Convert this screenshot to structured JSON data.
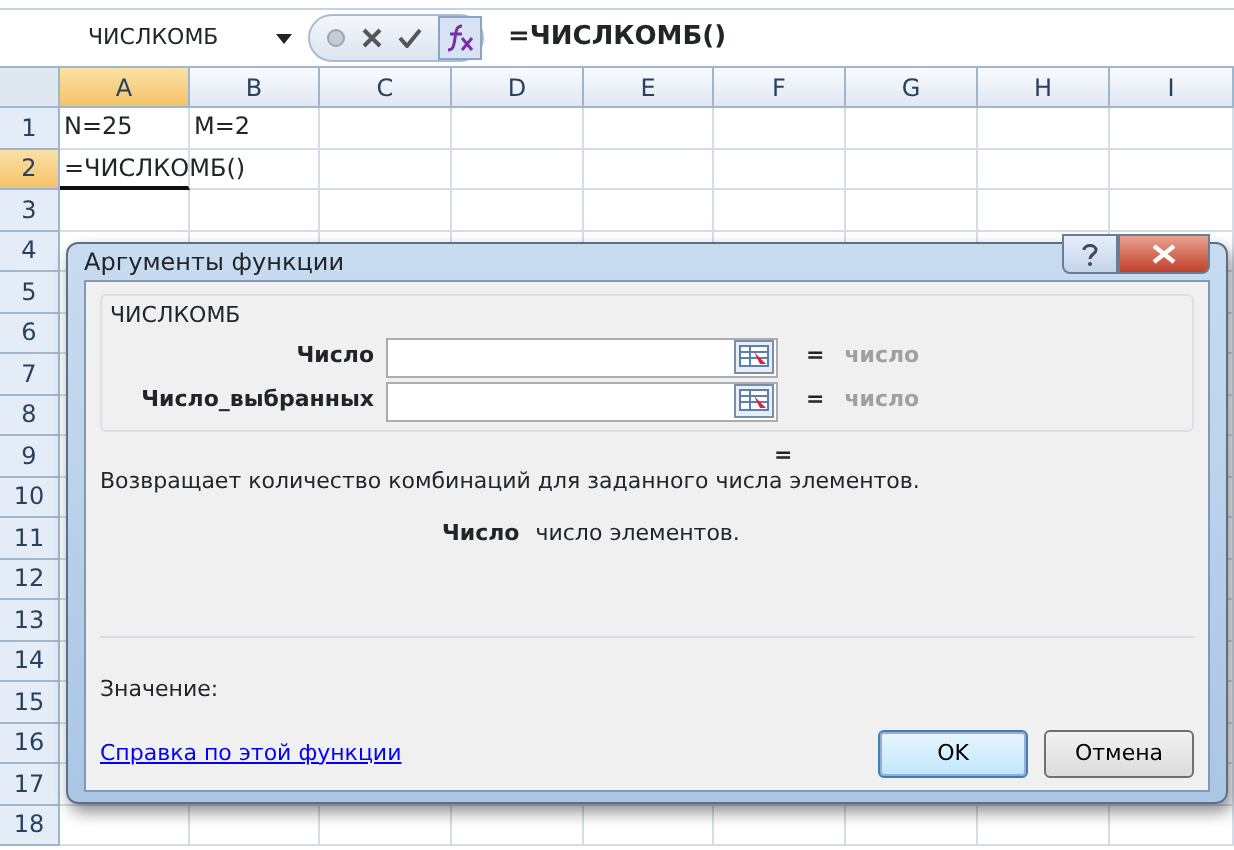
{
  "name_box": {
    "value": "ЧИСЛКОМБ"
  },
  "formula_bar": {
    "value": "=ЧИСЛКОМБ()"
  },
  "columns": [
    {
      "label": "A",
      "selected": true
    },
    {
      "label": "B",
      "selected": false
    },
    {
      "label": "C",
      "selected": false
    },
    {
      "label": "D",
      "selected": false
    },
    {
      "label": "E",
      "selected": false
    },
    {
      "label": "F",
      "selected": false
    },
    {
      "label": "G",
      "selected": false
    },
    {
      "label": "H",
      "selected": false
    },
    {
      "label": "I",
      "selected": false
    }
  ],
  "rows": [
    {
      "label": "1",
      "selected": false,
      "cells": [
        "N=25",
        "M=2"
      ]
    },
    {
      "label": "2",
      "selected": true,
      "cells": [
        "=ЧИСЛКОМБ()"
      ]
    },
    {
      "label": "3",
      "selected": false
    },
    {
      "label": "4",
      "selected": false
    },
    {
      "label": "5",
      "selected": false
    },
    {
      "label": "6",
      "selected": false
    },
    {
      "label": "7",
      "selected": false
    },
    {
      "label": "8",
      "selected": false
    },
    {
      "label": "9",
      "selected": false
    },
    {
      "label": "10",
      "selected": false
    },
    {
      "label": "11",
      "selected": false
    },
    {
      "label": "12",
      "selected": false
    },
    {
      "label": "13",
      "selected": false
    },
    {
      "label": "14",
      "selected": false
    },
    {
      "label": "15",
      "selected": false
    },
    {
      "label": "16",
      "selected": false
    },
    {
      "label": "17",
      "selected": false
    },
    {
      "label": "18",
      "selected": false
    }
  ],
  "dialog": {
    "title": "Аргументы функции",
    "group_label": "ЧИСЛКОМБ",
    "arguments": [
      {
        "label": "Число",
        "equals": "=",
        "result": "число"
      },
      {
        "label": "Число_выбранных",
        "equals": "=",
        "result": "число"
      }
    ],
    "total_equals": "=",
    "description": "Возвращает количество комбинаций для заданного числа элементов.",
    "argument_help": {
      "name": "Число",
      "text": "число элементов."
    },
    "value_label": "Значение:",
    "help_link": "Справка по этой функции",
    "buttons": [
      {
        "label": "OK",
        "default": true
      },
      {
        "label": "Отмена",
        "default": false
      }
    ]
  }
}
